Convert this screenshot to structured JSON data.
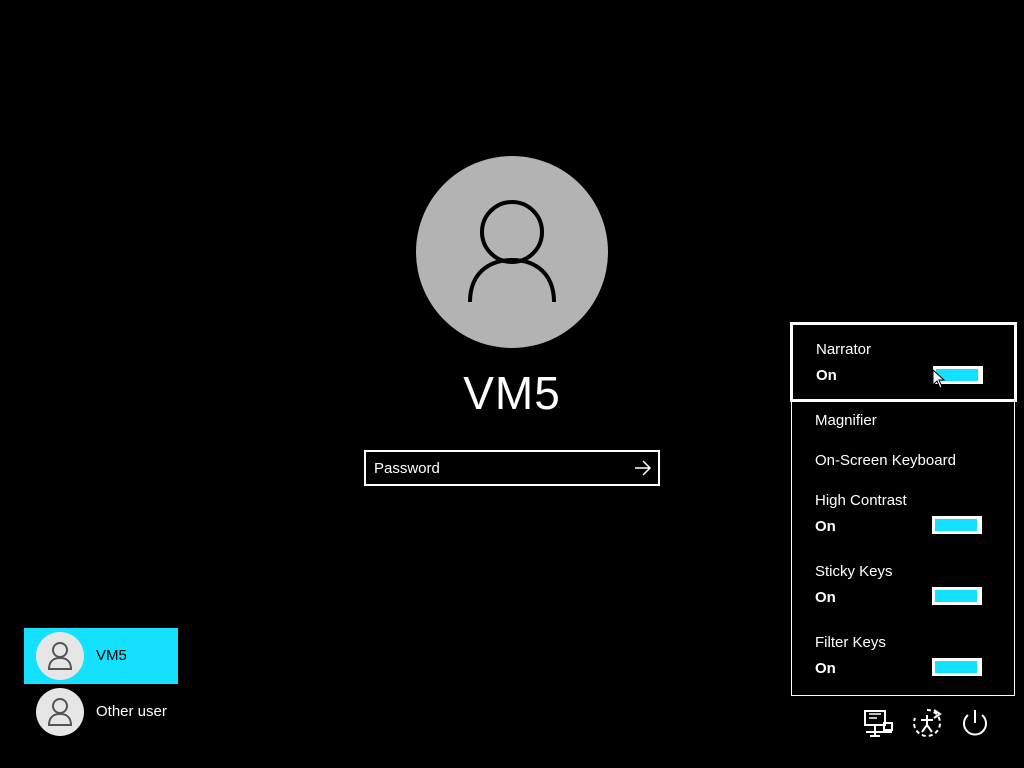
{
  "user": {
    "name": "VM5"
  },
  "password": {
    "placeholder": "Password"
  },
  "user_list": [
    {
      "label": "VM5",
      "selected": true
    },
    {
      "label": "Other user",
      "selected": false
    }
  ],
  "ease_of_access": {
    "items": [
      {
        "name": "Narrator",
        "state": "On",
        "toggle_on": true
      },
      {
        "name": "Magnifier"
      },
      {
        "name": "On-Screen Keyboard"
      },
      {
        "name": "High Contrast",
        "state": "On",
        "toggle_on": true
      },
      {
        "name": "Sticky Keys",
        "state": "On",
        "toggle_on": true
      },
      {
        "name": "Filter Keys",
        "state": "On",
        "toggle_on": true
      }
    ]
  },
  "system_icons": [
    "network-icon",
    "ease-of-access-icon",
    "power-icon"
  ],
  "colors": {
    "accent": "#14e1ff",
    "background": "#000000",
    "avatar": "#b3b3b3"
  }
}
